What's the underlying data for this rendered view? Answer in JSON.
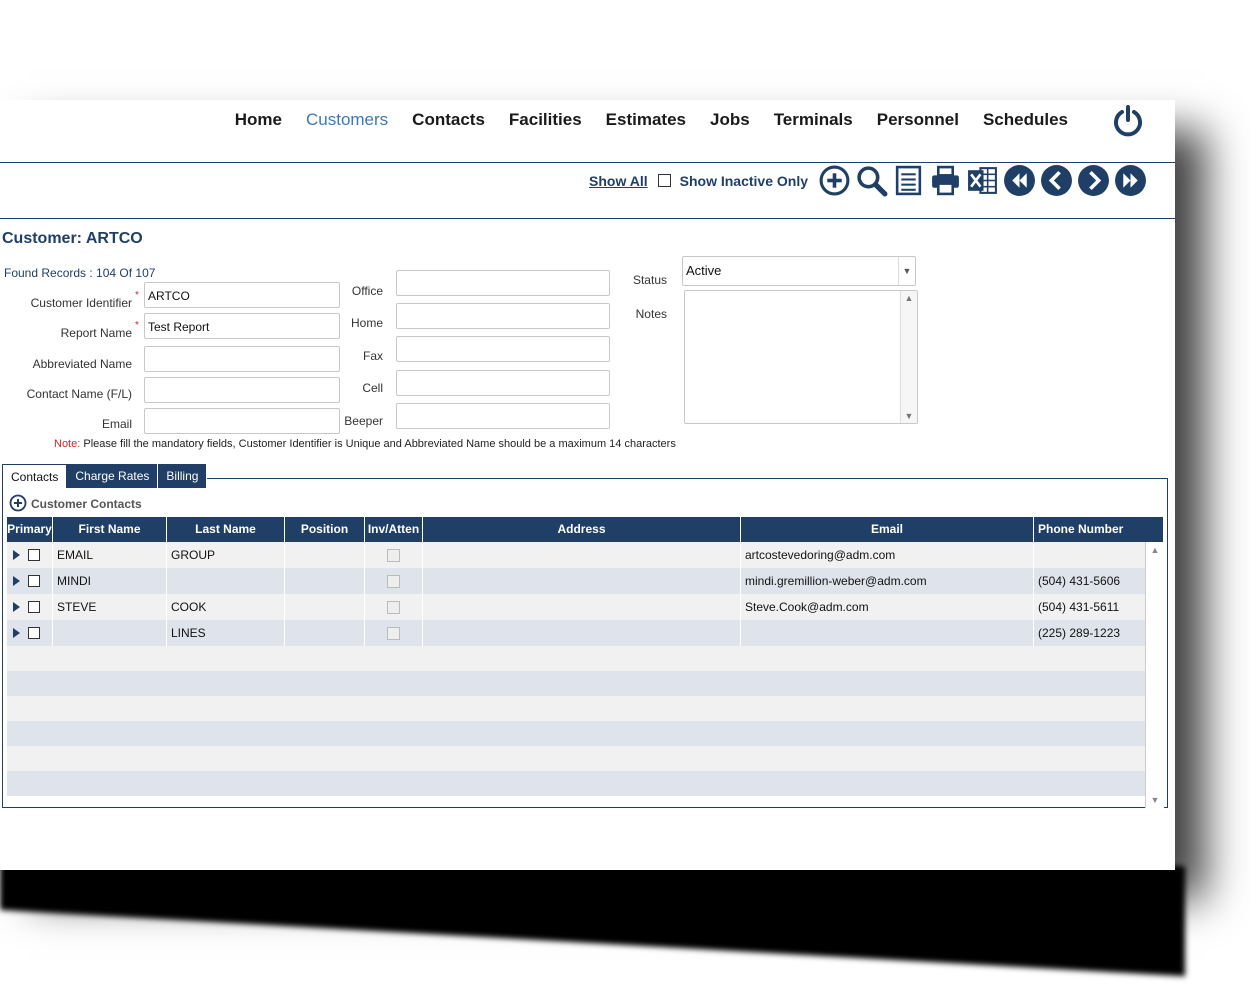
{
  "nav": {
    "items": [
      "Home",
      "Customers",
      "Contacts",
      "Facilities",
      "Estimates",
      "Jobs",
      "Terminals",
      "Personnel",
      "Schedules"
    ],
    "active": "Customers"
  },
  "toolbar": {
    "show_all": "Show All",
    "show_inactive": "Show Inactive Only",
    "icons": [
      "add-icon",
      "search-icon",
      "list-icon",
      "print-icon",
      "excel-icon",
      "first-icon",
      "prev-icon",
      "next-icon",
      "last-icon"
    ]
  },
  "customer": {
    "title": "Customer: ARTCO",
    "found": "Found Records : 104 Of 107"
  },
  "form": {
    "labels": {
      "customer_identifier": "Customer Identifier",
      "report_name": "Report Name",
      "abbreviated_name": "Abbreviated Name",
      "contact_name": "Contact Name (F/L)",
      "email": "Email",
      "office": "Office",
      "home": "Home",
      "fax": "Fax",
      "cell": "Cell",
      "beeper": "Beeper",
      "status": "Status",
      "notes": "Notes",
      "required_mark": "*"
    },
    "values": {
      "customer_identifier": "ARTCO",
      "report_name": "Test Report",
      "abbreviated_name": "",
      "contact_name": "",
      "email": "",
      "office": "",
      "home": "",
      "fax": "",
      "cell": "",
      "beeper": "",
      "status": "Active",
      "notes": ""
    },
    "note_prefix": "Note:",
    "note_text": " Please fill the mandatory fields, Customer Identifier is Unique and Abbreviated Name should be a maximum 14 characters"
  },
  "tabs": [
    "Contacts",
    "Charge Rates",
    "Billing"
  ],
  "contacts": {
    "title": "Customer Contacts",
    "columns": [
      "Primary",
      "First Name",
      "Last Name",
      "Position",
      "Inv/Atten",
      "Address",
      "Email",
      "Phone Number"
    ],
    "rows": [
      {
        "first": "EMAIL",
        "last": "GROUP",
        "position": "",
        "address": "",
        "email": "artcostevedoring@adm.com",
        "phone": ""
      },
      {
        "first": "MINDI",
        "last": "",
        "position": "",
        "address": "",
        "email": "mindi.gremillion-weber@adm.com",
        "phone": "(504) 431-5606"
      },
      {
        "first": "STEVE",
        "last": "COOK",
        "position": "",
        "address": "",
        "email": "Steve.Cook@adm.com",
        "phone": "(504) 431-5611"
      },
      {
        "first": "",
        "last": "LINES",
        "position": "",
        "address": "",
        "email": "",
        "phone": "(225) 289-1223"
      }
    ]
  },
  "colors": {
    "primary": "#1f3f66",
    "accent": "#3f78b5",
    "required": "#c62828",
    "row_alt": "#dfe4ec"
  }
}
